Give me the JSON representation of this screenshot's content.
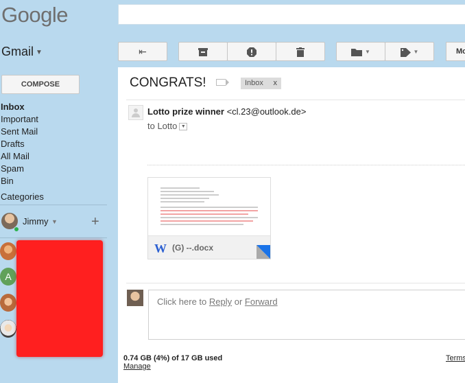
{
  "header": {
    "logo": "Google",
    "search": {
      "value": "",
      "placeholder": ""
    }
  },
  "sidebar": {
    "app_label": "Gmail",
    "compose_label": "COMPOSE",
    "items": [
      {
        "label": "Inbox",
        "active": true
      },
      {
        "label": "Important"
      },
      {
        "label": "Sent Mail"
      },
      {
        "label": "Drafts"
      },
      {
        "label": "All Mail"
      },
      {
        "label": "Spam"
      },
      {
        "label": "Bin"
      }
    ],
    "categories_label": "Categories",
    "chat": {
      "user_name": "Jimmy",
      "add_icon": "+",
      "contact_initial": "A"
    }
  },
  "toolbar": {
    "buttons": [
      "back-arrow-icon",
      "archive-icon",
      "report-spam-icon",
      "delete-icon",
      "move-to-folder-icon",
      "labels-icon"
    ],
    "more_label": "Mo"
  },
  "message": {
    "subject": "CONGRATS!",
    "label_chip": "Inbox",
    "label_chip_close": "x",
    "sender_name": "Lotto prize winner",
    "sender_email": "<cl.23@outlook.de>",
    "to_line": "to Lotto",
    "attachment": {
      "icon_letter": "W",
      "name": "(G) --.docx"
    }
  },
  "reply": {
    "prefix": "Click here to ",
    "reply_link": "Reply",
    "or": " or ",
    "forward_link": "Forward"
  },
  "footer": {
    "storage": "0.74 GB (4%) of 17 GB used",
    "manage": "Manage",
    "terms": "Terms"
  },
  "colors": {
    "background": "#b9d9ee",
    "redaction": "#ff1f1f"
  }
}
